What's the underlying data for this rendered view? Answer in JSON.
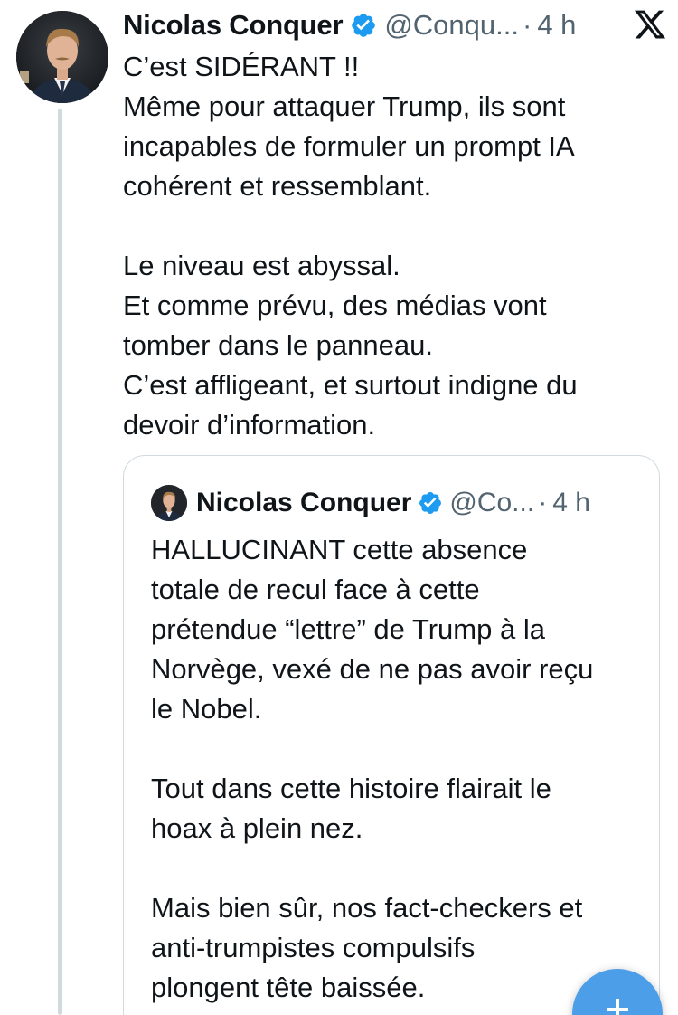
{
  "post": {
    "author_name": "Nicolas Conquer",
    "handle": "@Conqu...",
    "separator": "·",
    "time": "4 h",
    "text_lines": [
      "C’est SIDÉRANT !!",
      "Même pour attaquer Trump, ils sont",
      "incapables de formuler un prompt IA",
      "cohérent et ressemblant.",
      "",
      "Le niveau est abyssal.",
      "Et comme prévu, des médias vont",
      "tomber dans le panneau.",
      "C’est affligeant, et surtout indigne du",
      "devoir d’information."
    ]
  },
  "quoted_post": {
    "author_name": "Nicolas Conquer",
    "handle": "@Co...",
    "separator": "·",
    "time": "4 h",
    "text_lines": [
      "HALLUCINANT cette absence",
      "totale de recul face à cette",
      "prétendue “lettre” de Trump à la",
      "Norvège, vexé de ne pas avoir reçu",
      "le Nobel.",
      "",
      "Tout dans cette histoire flairait le",
      "hoax à plein nez.",
      "",
      "Mais bien sûr, nos fact-checkers et",
      "anti-trumpistes compulsifs",
      "plongent tête baissée."
    ]
  },
  "icons": {
    "verified": "verified-badge-icon",
    "platform": "x-logo-icon",
    "compose": "plus-icon"
  },
  "colors": {
    "verified_blue": "#1d9bf0",
    "secondary_text": "#536471",
    "border": "#cfd9de",
    "fab_blue": "#4c9ee8"
  }
}
